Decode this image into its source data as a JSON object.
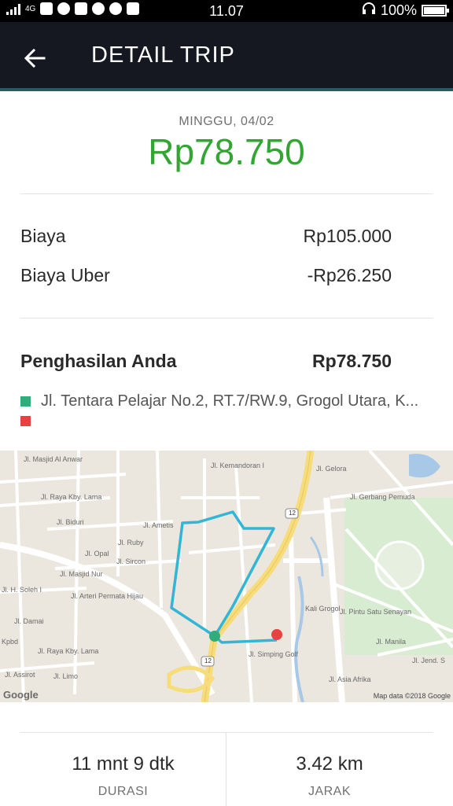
{
  "status_bar": {
    "time": "11.07",
    "network": "4G",
    "battery": "100%"
  },
  "header": {
    "title": "DETAIL TRIP"
  },
  "trip": {
    "date": "MINGGU, 04/02",
    "total": "Rp78.750"
  },
  "fare": {
    "biaya_label": "Biaya",
    "biaya_value": "Rp105.000",
    "uber_label": "Biaya Uber",
    "uber_value": "-Rp26.250",
    "earnings_label": "Penghasilan Anda",
    "earnings_value": "Rp78.750"
  },
  "route": {
    "pickup": "Jl. Tentara Pelajar No.2, RT.7/RW.9, Grogol Utara, K...",
    "dropoff": "",
    "pickup_color": "#2fae7b",
    "dropoff_color": "#e84141"
  },
  "map": {
    "labels": [
      "Jl. Masjid Al Anwar",
      "Jl. Raya Kby. Lama",
      "Jl. Biduri",
      "Jl. Opal",
      "Jl. Ruby",
      "Jl. Sircon",
      "Jl. Masjid Nur",
      "Jl. Ametis",
      "Jl. Arteri Permata Hijau",
      "Jl. H. Soleh I",
      "Jl. Damai",
      "Jl. Raya Kby. Lama",
      "Kpbd",
      "Jl. Assirot",
      "Jl. Limo",
      "Jl. Kemandoran I",
      "Jl. Gelora",
      "Jl. Gerbang Pemuda",
      "Jl. Pintu Satu Senayan",
      "Jl. Manila",
      "Jl. Simping Golf",
      "Jl. Asia Afrika",
      "Kali Grogol",
      "12",
      "12",
      "Jl. Jend. S"
    ],
    "google": "Google",
    "attribution": "Map data ©2018 Google",
    "route_color": "#33b6d6"
  },
  "stats": {
    "duration_value": "11 mnt 9 dtk",
    "duration_label": "DURASI",
    "distance_value": "3.42 km",
    "distance_label": "JARAK"
  }
}
